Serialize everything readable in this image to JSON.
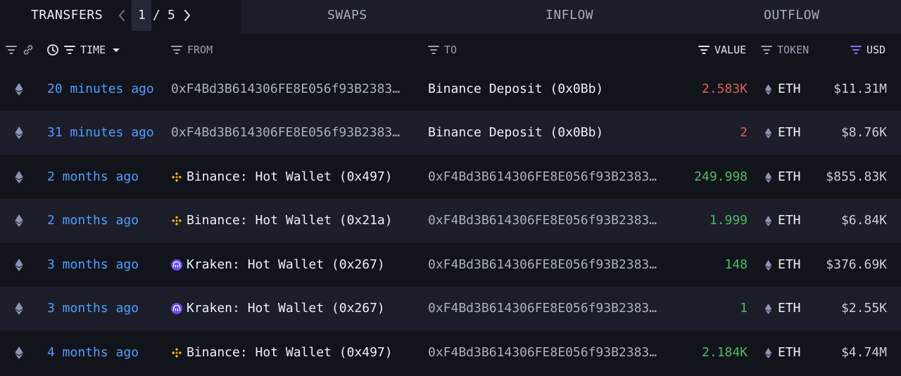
{
  "tabs": {
    "transfers": "TRANSFERS",
    "pager_current": "1",
    "pager_sep": "/",
    "pager_total": "5",
    "swaps": "SWAPS",
    "inflow": "INFLOW",
    "outflow": "OUTFLOW"
  },
  "header": {
    "time": "TIME",
    "from": "FROM",
    "to": "TO",
    "value": "VALUE",
    "token": "TOKEN",
    "usd": "USD"
  },
  "colors": {
    "time_link": "#4f9dff",
    "value_out": "#e05a5a",
    "value_in": "#4fb96a",
    "usd_filter_accent": "#8b6cf5",
    "binance": "#f0b90b",
    "kraken": "#6c4cf0"
  },
  "rows": [
    {
      "chain_icon": "eth-icon",
      "time": "20 minutes ago",
      "from": "0xF4Bd3B614306FE8E056f93B2383…",
      "from_logo": "",
      "to": "Binance Deposit (0x0Bb)",
      "to_logo": "",
      "value": "2.583K",
      "direction": "out",
      "token": "ETH",
      "usd": "$11.31M"
    },
    {
      "chain_icon": "eth-icon",
      "time": "31 minutes ago",
      "from": "0xF4Bd3B614306FE8E056f93B2383…",
      "from_logo": "",
      "to": "Binance Deposit (0x0Bb)",
      "to_logo": "",
      "value": "2",
      "direction": "out",
      "token": "ETH",
      "usd": "$8.76K"
    },
    {
      "chain_icon": "eth-icon",
      "time": "2 months ago",
      "from": "Binance: Hot Wallet (0x497)",
      "from_logo": "binance-icon",
      "to": "0xF4Bd3B614306FE8E056f93B2383…",
      "to_logo": "",
      "value": "249.998",
      "direction": "in",
      "token": "ETH",
      "usd": "$855.83K"
    },
    {
      "chain_icon": "eth-icon",
      "time": "2 months ago",
      "from": "Binance: Hot Wallet (0x21a)",
      "from_logo": "binance-icon",
      "to": "0xF4Bd3B614306FE8E056f93B2383…",
      "to_logo": "",
      "value": "1.999",
      "direction": "in",
      "token": "ETH",
      "usd": "$6.84K"
    },
    {
      "chain_icon": "eth-icon",
      "time": "3 months ago",
      "from": "Kraken: Hot Wallet (0x267)",
      "from_logo": "kraken-icon",
      "to": "0xF4Bd3B614306FE8E056f93B2383…",
      "to_logo": "",
      "value": "148",
      "direction": "in",
      "token": "ETH",
      "usd": "$376.69K"
    },
    {
      "chain_icon": "eth-icon",
      "time": "3 months ago",
      "from": "Kraken: Hot Wallet (0x267)",
      "from_logo": "kraken-icon",
      "to": "0xF4Bd3B614306FE8E056f93B2383…",
      "to_logo": "",
      "value": "1",
      "direction": "in",
      "token": "ETH",
      "usd": "$2.55K"
    },
    {
      "chain_icon": "eth-icon",
      "time": "4 months ago",
      "from": "Binance: Hot Wallet (0x497)",
      "from_logo": "binance-icon",
      "to": "0xF4Bd3B614306FE8E056f93B2383…",
      "to_logo": "",
      "value": "2.184K",
      "direction": "in",
      "token": "ETH",
      "usd": "$4.74M"
    }
  ]
}
